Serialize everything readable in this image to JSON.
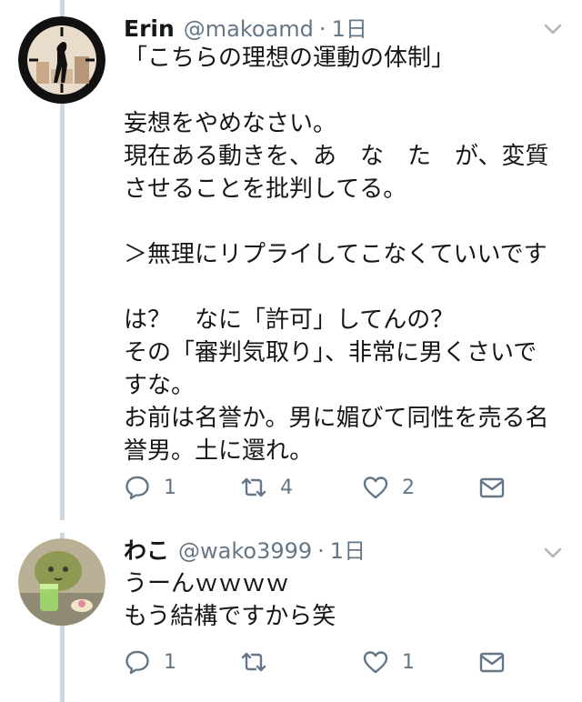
{
  "tweets": [
    {
      "name": "Erin",
      "handle": "@makoamd",
      "separator": "·",
      "time": "1日",
      "text": "「こちらの理想の運動の体制」\n\n妄想をやめなさい。\n現在ある動きを、あ　な　た　が、変質\nさせることを批判してる。\n\n＞無理にリプライしてこなくていいです\n\nは？　なに「許可」してんの？\nその「審判気取り」、非常に男くさいで\nすな。\nお前は名誉か。男に媚びて同性を売る名\n誉男。土に還れ。",
      "replies": "1",
      "retweets": "4",
      "likes": "2"
    },
    {
      "name": "わこ",
      "handle": "@wako3999",
      "separator": "·",
      "time": "1日",
      "text": "うーんｗｗｗｗ\nもう結構ですから笑",
      "replies": "1",
      "retweets": "",
      "likes": "1"
    }
  ],
  "icons": {
    "reply": "reply-icon",
    "retweet": "retweet-icon",
    "like": "heart-icon",
    "dm": "envelope-icon",
    "menu": "chevron-down-icon"
  },
  "colors": {
    "icon_gray": "#657786",
    "text": "#14171a",
    "thread_line": "#ccd6dd"
  }
}
